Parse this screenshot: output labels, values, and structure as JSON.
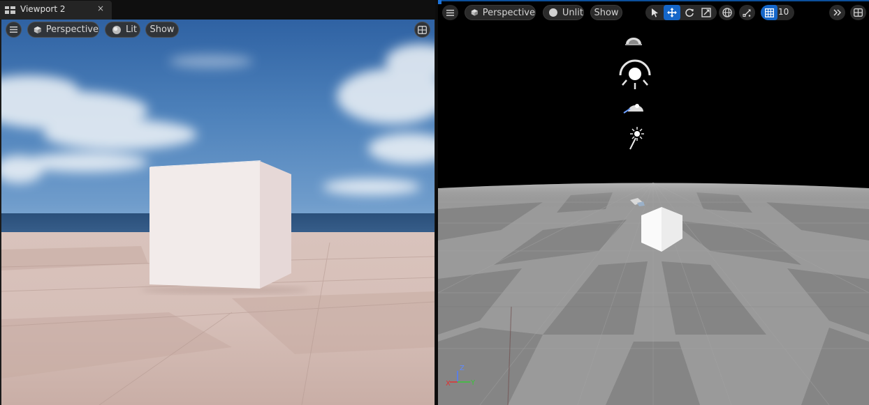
{
  "left_panel": {
    "tab": {
      "title": "Viewport 2",
      "close": "×"
    },
    "toolbar": {
      "menu_icon": "hamburger-icon",
      "perspective_label": "Perspective",
      "lit_label": "Lit",
      "show_label": "Show",
      "layout_icon": "layout-grid-icon"
    }
  },
  "right_panel": {
    "toolbar": {
      "menu_icon": "hamburger-icon",
      "perspective_label": "Perspective",
      "unlit_label": "Unlit",
      "show_label": "Show",
      "tools": [
        "select-icon",
        "translate-icon",
        "rotate-icon",
        "scale-icon",
        "world-icon",
        "surface-snap-icon"
      ],
      "grid_snap_value": "10",
      "overflow_icon": "chevron-double-right-icon",
      "layout_icon": "layout-grid-icon"
    },
    "gizmo_axes": {
      "z": "Z",
      "y": "Y",
      "x": "X"
    },
    "scene_icons": [
      "sky-atmosphere-icon",
      "directional-light-icon",
      "skylight-icon",
      "exponential-fog-icon",
      "player-start-icon"
    ]
  },
  "colors": {
    "accent_blue": "#1566c8",
    "axis_x": "#e03030",
    "axis_y": "#36c836",
    "axis_z": "#4f7bff"
  }
}
